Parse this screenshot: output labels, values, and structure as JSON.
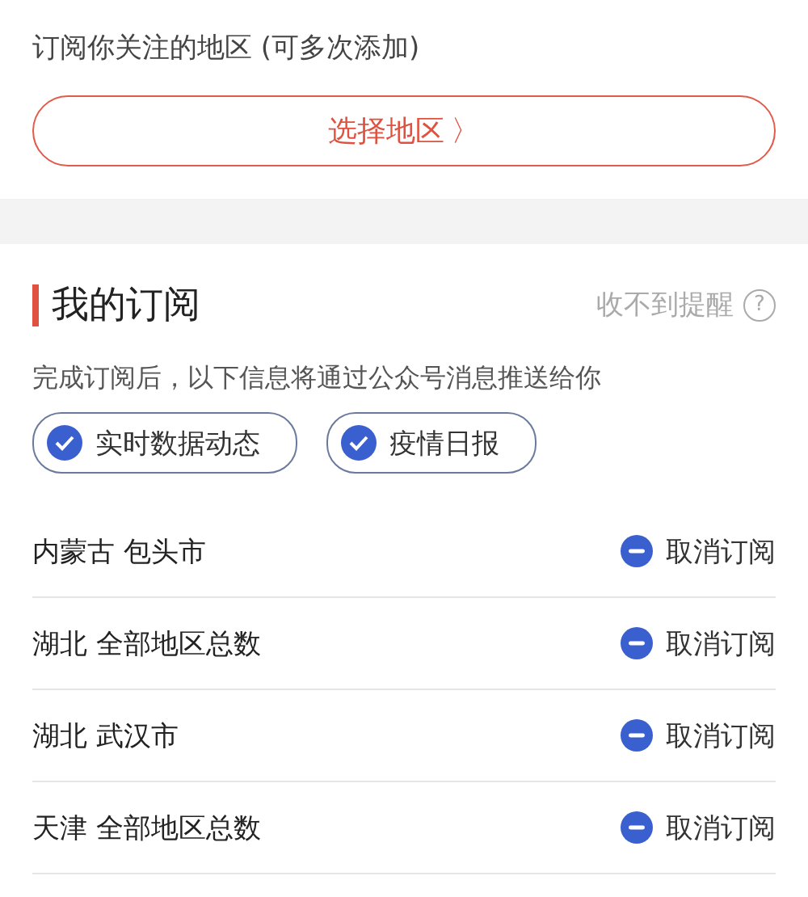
{
  "subscribe": {
    "title": "订阅你关注的地区 (可多次添加)",
    "button": "选择地区",
    "button_caret": "〉"
  },
  "my_subscriptions": {
    "title": "我的订阅",
    "help_link": "收不到提醒",
    "help_icon": "?",
    "description": "完成订阅后，以下信息将通过公众号消息推送给你",
    "options": [
      {
        "label": "实时数据动态",
        "checked": true
      },
      {
        "label": "疫情日报",
        "checked": true
      }
    ],
    "regions": [
      {
        "name": "内蒙古 包头市",
        "action": "取消订阅"
      },
      {
        "name": "湖北 全部地区总数",
        "action": "取消订阅"
      },
      {
        "name": "湖北 武汉市",
        "action": "取消订阅"
      },
      {
        "name": "天津 全部地区总数",
        "action": "取消订阅"
      }
    ]
  }
}
